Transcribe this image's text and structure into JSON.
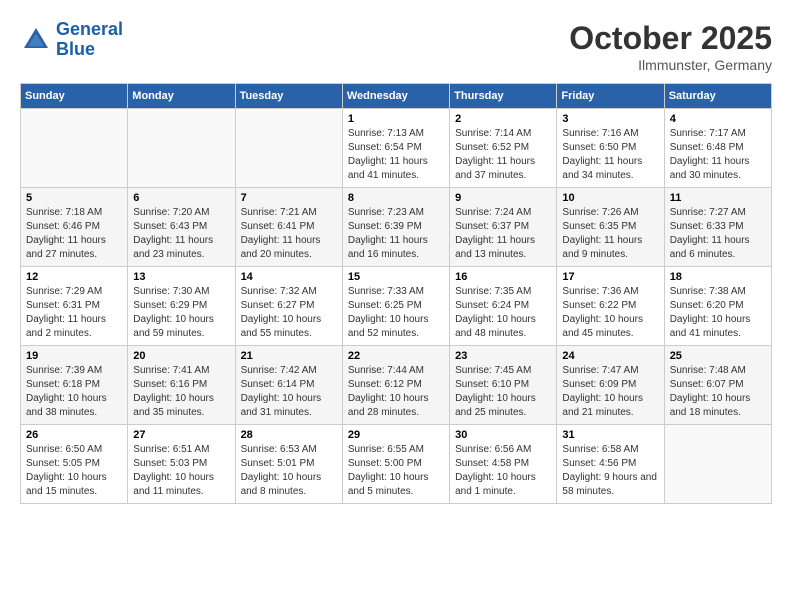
{
  "header": {
    "logo_line1": "General",
    "logo_line2": "Blue",
    "month": "October 2025",
    "location": "Ilmmunster, Germany"
  },
  "weekdays": [
    "Sunday",
    "Monday",
    "Tuesday",
    "Wednesday",
    "Thursday",
    "Friday",
    "Saturday"
  ],
  "weeks": [
    [
      {
        "day": "",
        "sunrise": "",
        "sunset": "",
        "daylight": ""
      },
      {
        "day": "",
        "sunrise": "",
        "sunset": "",
        "daylight": ""
      },
      {
        "day": "",
        "sunrise": "",
        "sunset": "",
        "daylight": ""
      },
      {
        "day": "1",
        "sunrise": "Sunrise: 7:13 AM",
        "sunset": "Sunset: 6:54 PM",
        "daylight": "Daylight: 11 hours and 41 minutes."
      },
      {
        "day": "2",
        "sunrise": "Sunrise: 7:14 AM",
        "sunset": "Sunset: 6:52 PM",
        "daylight": "Daylight: 11 hours and 37 minutes."
      },
      {
        "day": "3",
        "sunrise": "Sunrise: 7:16 AM",
        "sunset": "Sunset: 6:50 PM",
        "daylight": "Daylight: 11 hours and 34 minutes."
      },
      {
        "day": "4",
        "sunrise": "Sunrise: 7:17 AM",
        "sunset": "Sunset: 6:48 PM",
        "daylight": "Daylight: 11 hours and 30 minutes."
      }
    ],
    [
      {
        "day": "5",
        "sunrise": "Sunrise: 7:18 AM",
        "sunset": "Sunset: 6:46 PM",
        "daylight": "Daylight: 11 hours and 27 minutes."
      },
      {
        "day": "6",
        "sunrise": "Sunrise: 7:20 AM",
        "sunset": "Sunset: 6:43 PM",
        "daylight": "Daylight: 11 hours and 23 minutes."
      },
      {
        "day": "7",
        "sunrise": "Sunrise: 7:21 AM",
        "sunset": "Sunset: 6:41 PM",
        "daylight": "Daylight: 11 hours and 20 minutes."
      },
      {
        "day": "8",
        "sunrise": "Sunrise: 7:23 AM",
        "sunset": "Sunset: 6:39 PM",
        "daylight": "Daylight: 11 hours and 16 minutes."
      },
      {
        "day": "9",
        "sunrise": "Sunrise: 7:24 AM",
        "sunset": "Sunset: 6:37 PM",
        "daylight": "Daylight: 11 hours and 13 minutes."
      },
      {
        "day": "10",
        "sunrise": "Sunrise: 7:26 AM",
        "sunset": "Sunset: 6:35 PM",
        "daylight": "Daylight: 11 hours and 9 minutes."
      },
      {
        "day": "11",
        "sunrise": "Sunrise: 7:27 AM",
        "sunset": "Sunset: 6:33 PM",
        "daylight": "Daylight: 11 hours and 6 minutes."
      }
    ],
    [
      {
        "day": "12",
        "sunrise": "Sunrise: 7:29 AM",
        "sunset": "Sunset: 6:31 PM",
        "daylight": "Daylight: 11 hours and 2 minutes."
      },
      {
        "day": "13",
        "sunrise": "Sunrise: 7:30 AM",
        "sunset": "Sunset: 6:29 PM",
        "daylight": "Daylight: 10 hours and 59 minutes."
      },
      {
        "day": "14",
        "sunrise": "Sunrise: 7:32 AM",
        "sunset": "Sunset: 6:27 PM",
        "daylight": "Daylight: 10 hours and 55 minutes."
      },
      {
        "day": "15",
        "sunrise": "Sunrise: 7:33 AM",
        "sunset": "Sunset: 6:25 PM",
        "daylight": "Daylight: 10 hours and 52 minutes."
      },
      {
        "day": "16",
        "sunrise": "Sunrise: 7:35 AM",
        "sunset": "Sunset: 6:24 PM",
        "daylight": "Daylight: 10 hours and 48 minutes."
      },
      {
        "day": "17",
        "sunrise": "Sunrise: 7:36 AM",
        "sunset": "Sunset: 6:22 PM",
        "daylight": "Daylight: 10 hours and 45 minutes."
      },
      {
        "day": "18",
        "sunrise": "Sunrise: 7:38 AM",
        "sunset": "Sunset: 6:20 PM",
        "daylight": "Daylight: 10 hours and 41 minutes."
      }
    ],
    [
      {
        "day": "19",
        "sunrise": "Sunrise: 7:39 AM",
        "sunset": "Sunset: 6:18 PM",
        "daylight": "Daylight: 10 hours and 38 minutes."
      },
      {
        "day": "20",
        "sunrise": "Sunrise: 7:41 AM",
        "sunset": "Sunset: 6:16 PM",
        "daylight": "Daylight: 10 hours and 35 minutes."
      },
      {
        "day": "21",
        "sunrise": "Sunrise: 7:42 AM",
        "sunset": "Sunset: 6:14 PM",
        "daylight": "Daylight: 10 hours and 31 minutes."
      },
      {
        "day": "22",
        "sunrise": "Sunrise: 7:44 AM",
        "sunset": "Sunset: 6:12 PM",
        "daylight": "Daylight: 10 hours and 28 minutes."
      },
      {
        "day": "23",
        "sunrise": "Sunrise: 7:45 AM",
        "sunset": "Sunset: 6:10 PM",
        "daylight": "Daylight: 10 hours and 25 minutes."
      },
      {
        "day": "24",
        "sunrise": "Sunrise: 7:47 AM",
        "sunset": "Sunset: 6:09 PM",
        "daylight": "Daylight: 10 hours and 21 minutes."
      },
      {
        "day": "25",
        "sunrise": "Sunrise: 7:48 AM",
        "sunset": "Sunset: 6:07 PM",
        "daylight": "Daylight: 10 hours and 18 minutes."
      }
    ],
    [
      {
        "day": "26",
        "sunrise": "Sunrise: 6:50 AM",
        "sunset": "Sunset: 5:05 PM",
        "daylight": "Daylight: 10 hours and 15 minutes."
      },
      {
        "day": "27",
        "sunrise": "Sunrise: 6:51 AM",
        "sunset": "Sunset: 5:03 PM",
        "daylight": "Daylight: 10 hours and 11 minutes."
      },
      {
        "day": "28",
        "sunrise": "Sunrise: 6:53 AM",
        "sunset": "Sunset: 5:01 PM",
        "daylight": "Daylight: 10 hours and 8 minutes."
      },
      {
        "day": "29",
        "sunrise": "Sunrise: 6:55 AM",
        "sunset": "Sunset: 5:00 PM",
        "daylight": "Daylight: 10 hours and 5 minutes."
      },
      {
        "day": "30",
        "sunrise": "Sunrise: 6:56 AM",
        "sunset": "Sunset: 4:58 PM",
        "daylight": "Daylight: 10 hours and 1 minute."
      },
      {
        "day": "31",
        "sunrise": "Sunrise: 6:58 AM",
        "sunset": "Sunset: 4:56 PM",
        "daylight": "Daylight: 9 hours and 58 minutes."
      },
      {
        "day": "",
        "sunrise": "",
        "sunset": "",
        "daylight": ""
      }
    ]
  ]
}
